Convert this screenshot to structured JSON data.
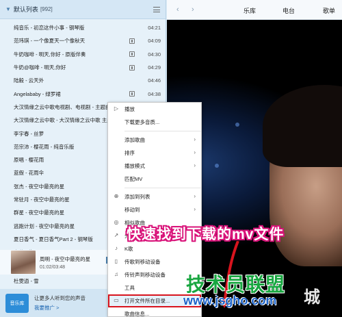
{
  "playlist": {
    "title": "默认列表",
    "count": "[992]",
    "songs": [
      {
        "title": "纯音乐 - 初恋这件小事 - 钢琴版",
        "mv": false,
        "duration": "04:21"
      },
      {
        "title": "范玮琪 - 一个像夏天一个像秋天",
        "mv": true,
        "duration": "04:09"
      },
      {
        "title": "牛奶咖啡 - 明天,你好 - 原版伴奏",
        "mv": true,
        "duration": "04:30"
      },
      {
        "title": "牛奶@咖啡 - 明天,你好",
        "mv": true,
        "duration": "04:29"
      },
      {
        "title": "陆毅 - 云天外",
        "mv": false,
        "duration": "04:46"
      },
      {
        "title": "Angelababy - 绿罗裙",
        "mv": true,
        "duration": "04:38"
      },
      {
        "title": "大汉情缘之云中歌电视剧、电视剧 - 主题曲",
        "mv": false,
        "duration": ""
      },
      {
        "title": "大汉情缘之云中歌 - 大汉情缘之云中歌 主题曲",
        "mv": false,
        "duration": ""
      },
      {
        "title": "李宇春 - 丝萝",
        "mv": false,
        "duration": ""
      },
      {
        "title": "范宗沛 - 樱花雨 - 纯音乐版",
        "mv": false,
        "duration": ""
      },
      {
        "title": "原唱 - 樱花雨",
        "mv": false,
        "duration": ""
      },
      {
        "title": "蓝假 - 花雨伞",
        "mv": false,
        "duration": ""
      },
      {
        "title": "张杰 - 夜空中最亮的星",
        "mv": false,
        "duration": ""
      },
      {
        "title": "常驻月 - 夜空中最亮的星",
        "mv": false,
        "duration": ""
      },
      {
        "title": "群星 - 夜空中最亮的星",
        "mv": false,
        "duration": ""
      },
      {
        "title": "逃跑计划 - 夜空中最亮的星",
        "mv": false,
        "duration": ""
      },
      {
        "title": "夏日香气 - 夏日香气Part 2 - 钢琴版",
        "mv": false,
        "duration": ""
      },
      {
        "title": "本兮 - 生日",
        "mv": false,
        "duration": ""
      }
    ],
    "now_playing": {
      "title": "周明 - 夜空中最亮的星",
      "time": "01:02/03:48"
    },
    "next_song": "杜雯逍 - 雪",
    "promo": {
      "logo": "音乐库",
      "line1": "让更多人听到您的声音",
      "link": "我要推广 >"
    }
  },
  "nav": {
    "back": "‹",
    "forward": "›",
    "tabs": [
      "乐库",
      "电台",
      "歌单"
    ]
  },
  "context_menu": {
    "items": [
      {
        "label": "播放",
        "icon": "play-icon",
        "glyph": "▷",
        "arrow": false,
        "sep_after": false
      },
      {
        "label": "下载更多音质...",
        "icon": "",
        "glyph": "",
        "arrow": false,
        "sep_after": true
      },
      {
        "label": "添加歌曲",
        "icon": "",
        "glyph": "",
        "arrow": true,
        "sep_after": false
      },
      {
        "label": "排序",
        "icon": "",
        "glyph": "",
        "arrow": true,
        "sep_after": false
      },
      {
        "label": "播放模式",
        "icon": "",
        "glyph": "",
        "arrow": true,
        "sep_after": false
      },
      {
        "label": "匹配MV",
        "icon": "",
        "glyph": "",
        "arrow": false,
        "sep_after": true
      },
      {
        "label": "添加到列表",
        "icon": "add-icon",
        "glyph": "⊕",
        "arrow": true,
        "sep_after": false
      },
      {
        "label": "移动到",
        "icon": "",
        "glyph": "",
        "arrow": true,
        "sep_after": false
      },
      {
        "label": "相似歌曲",
        "icon": "similar-icon",
        "glyph": "◎",
        "arrow": false,
        "sep_after": false
      },
      {
        "label": "分享",
        "icon": "share-icon",
        "glyph": "↗",
        "arrow": false,
        "sep_after": false
      },
      {
        "label": "K歌",
        "icon": "mic-icon",
        "glyph": "♪",
        "arrow": false,
        "sep_after": false
      },
      {
        "label": "传歌到移动设备",
        "icon": "phone-icon",
        "glyph": "▯",
        "arrow": false,
        "sep_after": false
      },
      {
        "label": "传铃声到移动设备",
        "icon": "bell-icon",
        "glyph": "♫",
        "arrow": false,
        "sep_after": false
      },
      {
        "label": "工具",
        "icon": "",
        "glyph": "",
        "arrow": false,
        "sep_after": false
      },
      {
        "label": "打开文件所在目录...",
        "icon": "folder-icon",
        "glyph": "▭",
        "arrow": false,
        "sep_after": false,
        "highlight": true
      },
      {
        "label": "歌曲信息...",
        "icon": "",
        "glyph": "",
        "arrow": false,
        "sep_after": false
      }
    ]
  },
  "overlay": {
    "caption": "快速找到下载的mv文件",
    "watermark_main": "技术员联盟",
    "watermark_url": "www.jsgho.com",
    "stamp_char": "城"
  },
  "colors": {
    "caption_outline": "#d9147a",
    "highlight_border": "#d8141e",
    "watermark_green": "#18a640",
    "watermark_blue": "#1a62c9"
  }
}
